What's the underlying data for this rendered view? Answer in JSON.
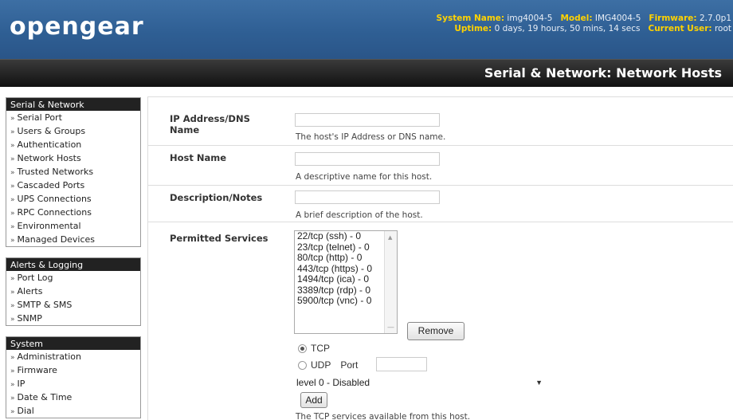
{
  "header": {
    "logo": "opengear",
    "system_name_label": "System Name:",
    "system_name": "img4004-5",
    "model_label": "Model:",
    "model": "IMG4004-5",
    "firmware_label": "Firmware:",
    "firmware": "2.7.0p1",
    "uptime_label": "Uptime:",
    "uptime": "0 days, 19 hours, 50 mins, 14 secs",
    "current_user_label": "Current User:",
    "current_user": "root"
  },
  "page_title": "Serial & Network: Network Hosts",
  "sidebar": {
    "groups": [
      {
        "title": "Serial & Network",
        "items": [
          "Serial Port",
          "Users & Groups",
          "Authentication",
          "Network Hosts",
          "Trusted Networks",
          "Cascaded Ports",
          "UPS Connections",
          "RPC Connections",
          "Environmental",
          "Managed Devices"
        ]
      },
      {
        "title": "Alerts & Logging",
        "items": [
          "Port Log",
          "Alerts",
          "SMTP & SMS",
          "SNMP"
        ]
      },
      {
        "title": "System",
        "items": [
          "Administration",
          "Firmware",
          "IP",
          "Date & Time",
          "Dial"
        ]
      }
    ]
  },
  "form": {
    "ip_address": {
      "label": "IP Address/DNS Name",
      "value": "",
      "help": "The host's IP Address or DNS name."
    },
    "host_name": {
      "label": "Host Name",
      "value": "",
      "help": "A descriptive name for this host."
    },
    "description": {
      "label": "Description/Notes",
      "value": "",
      "help": "A brief description of the host."
    },
    "permitted_services": {
      "label": "Permitted Services",
      "options": [
        "22/tcp (ssh) - 0",
        "23/tcp (telnet) - 0",
        "80/tcp (http) - 0",
        "443/tcp (https) - 0",
        "1494/tcp (ica) - 0",
        "3389/tcp (rdp) - 0",
        "5900/tcp (vnc) - 0"
      ],
      "remove_label": "Remove",
      "tcp_label": "TCP",
      "udp_label": "UDP",
      "port_label": "Port",
      "port_value": "",
      "protocol_selected": "TCP",
      "level_selected": "level 0 - Disabled",
      "add_label": "Add",
      "help": "The TCP services available from this host."
    }
  }
}
